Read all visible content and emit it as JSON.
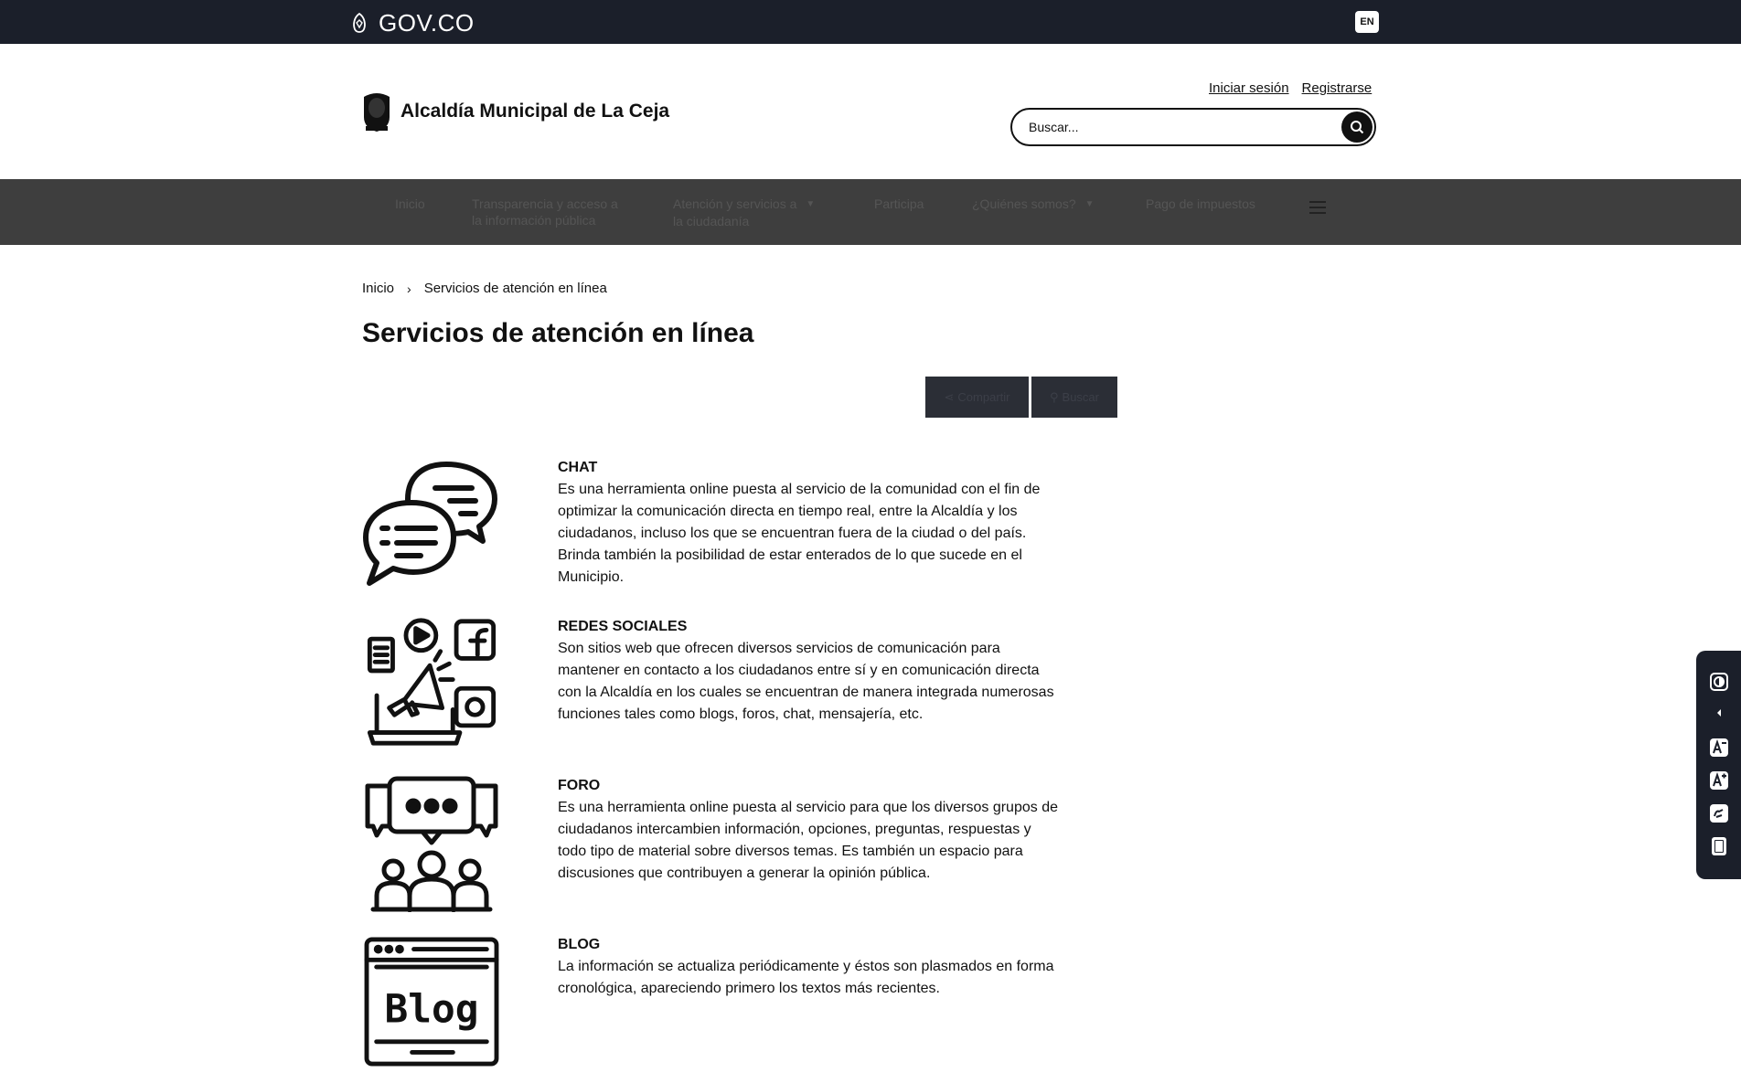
{
  "govbar": {
    "logo_text": "GOV.CO",
    "lang_label": "EN"
  },
  "header": {
    "site_name": "Alcaldía Municipal de La Ceja",
    "login": "Iniciar sesión",
    "register": "Registrarse",
    "search_placeholder": "Buscar..."
  },
  "nav": {
    "items": [
      {
        "label": "Inicio"
      },
      {
        "label_line1": "Transparencia y acceso a",
        "label_line2": "la información pública"
      },
      {
        "label_line1": "Atención y servicios a",
        "label_line2": "la ciudadanía"
      },
      {
        "label": "Participa"
      },
      {
        "label": "¿Quiénes somos?"
      },
      {
        "label": "Pago de impuestos"
      }
    ]
  },
  "breadcrumb": {
    "home": "Inicio",
    "separator": "›",
    "current": "Servicios de atención en línea"
  },
  "page": {
    "title": "Servicios de atención en línea",
    "share_label": "Compartir",
    "search_label": "Buscar"
  },
  "services": [
    {
      "title": "CHAT",
      "icon": "chat-bubbles-icon",
      "lines": [
        "Es una herramienta online puesta al servicio de la comunidad con el fin de",
        "optimizar la comunicación directa en tiempo real, entre la Alcaldía y los",
        "ciudadanos, incluso los que se encuentran fuera de la ciudad o del país.",
        "Brinda también la posibilidad de estar enterados de lo que sucede en el",
        "Municipio."
      ]
    },
    {
      "title": "REDES SOCIALES",
      "icon": "social-media-icon",
      "lines": [
        "Son sitios web que ofrecen diversos servicios de comunicación para",
        "mantener en contacto a los ciudadanos entre sí y en comunicación directa",
        "con la Alcaldía en los cuales se encuentran de manera integrada numerosas",
        "funciones tales como blogs, foros, chat, mensajería, etc."
      ]
    },
    {
      "title": "FORO",
      "icon": "forum-people-icon",
      "lines": [
        "Es una herramienta online puesta al servicio para que los diversos grupos de",
        "ciudadanos intercambien información, opciones, preguntas, respuestas y",
        "todo tipo de material sobre diversos temas. Es también un espacio para",
        "discusiones que contribuyen a generar la opinión pública."
      ]
    },
    {
      "title": "BLOG",
      "icon": "blog-window-icon",
      "icon_text": "Blog",
      "lines": [
        "La información se actualiza periódicamente y éstos son plasmados en forma",
        "cronológica, apareciendo primero los textos más recientes."
      ]
    }
  ]
}
